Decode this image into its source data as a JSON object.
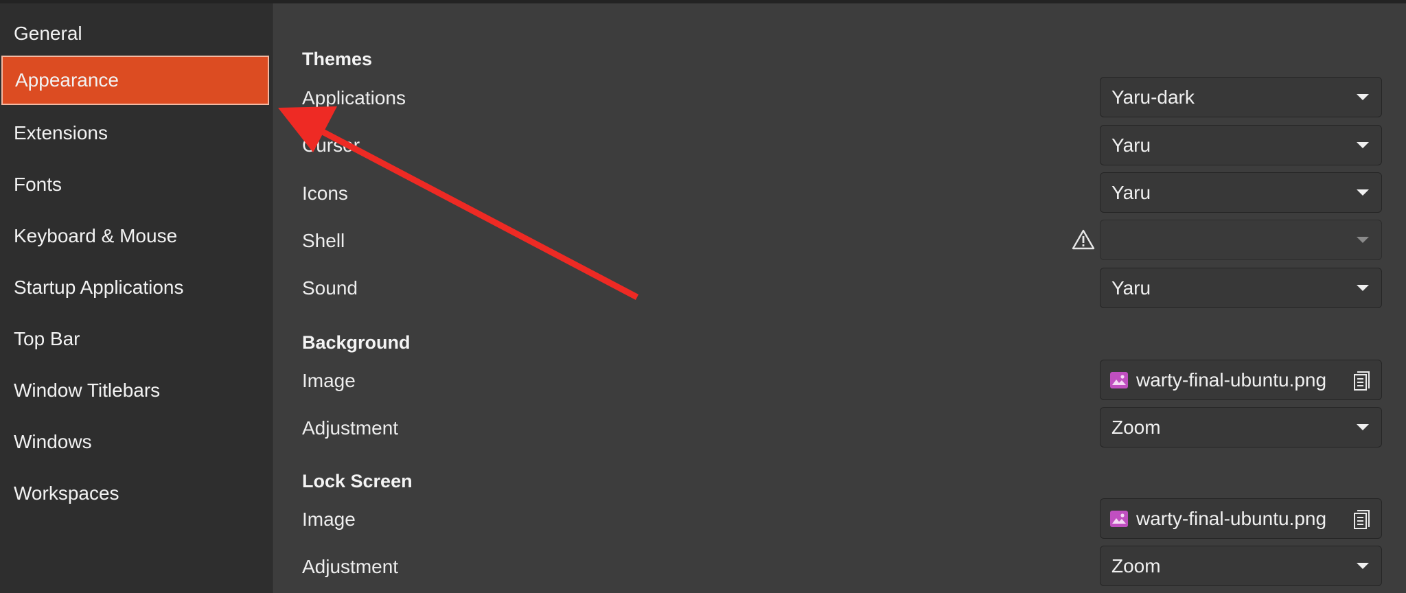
{
  "sidebar": {
    "items": [
      {
        "label": "General"
      },
      {
        "label": "Appearance",
        "selected": true
      },
      {
        "label": "Extensions"
      },
      {
        "label": "Fonts"
      },
      {
        "label": "Keyboard & Mouse"
      },
      {
        "label": "Startup Applications"
      },
      {
        "label": "Top Bar"
      },
      {
        "label": "Window Titlebars"
      },
      {
        "label": "Windows"
      },
      {
        "label": "Workspaces"
      }
    ]
  },
  "themes": {
    "title": "Themes",
    "applications": {
      "label": "Applications",
      "value": "Yaru-dark"
    },
    "cursor": {
      "label": "Cursor",
      "value": "Yaru"
    },
    "icons": {
      "label": "Icons",
      "value": "Yaru"
    },
    "shell": {
      "label": "Shell",
      "value": ""
    },
    "sound": {
      "label": "Sound",
      "value": "Yaru"
    }
  },
  "background": {
    "title": "Background",
    "image": {
      "label": "Image",
      "value": "warty-final-ubuntu.png"
    },
    "adjustment": {
      "label": "Adjustment",
      "value": "Zoom"
    }
  },
  "lock_screen": {
    "title": "Lock Screen",
    "image": {
      "label": "Image",
      "value": "warty-final-ubuntu.png"
    },
    "adjustment": {
      "label": "Adjustment",
      "value": "Zoom"
    }
  },
  "colors": {
    "accent": "#dc4c22",
    "annotation_arrow": "#ee2a24",
    "image_icon": "#c04fc0"
  },
  "icons": {
    "warning": "warning-triangle-icon",
    "dropdown": "chevron-down-icon",
    "image": "image-file-icon",
    "file_chooser": "document-icon"
  }
}
